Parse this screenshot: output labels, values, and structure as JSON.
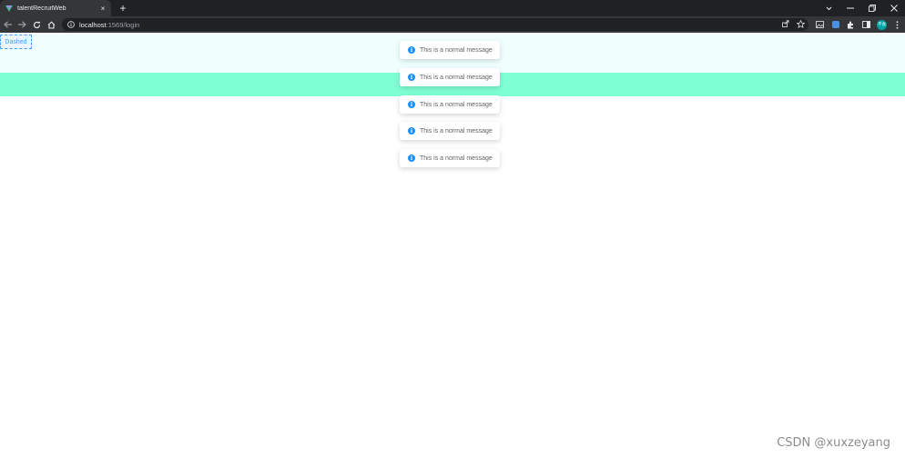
{
  "browser": {
    "tab_title": "talentRecruitWeb",
    "url_host": "localhost",
    "url_path": ":1569/login",
    "avatar_initials": "不会",
    "new_tab_symbol": "+",
    "close_symbol": "×"
  },
  "page": {
    "dashed_button_label": "Dashed",
    "band_light_color": "#effffe",
    "band_green_color": "#7fffd4",
    "messages": [
      {
        "text": "This is a normal message"
      },
      {
        "text": "This is a normal message"
      },
      {
        "text": "This is a normal message"
      },
      {
        "text": "This is a normal message"
      },
      {
        "text": "This is a normal message"
      }
    ],
    "message_icon": "info-icon",
    "message_icon_glyph": "i",
    "watermark": "CSDN @xuxzeyang"
  }
}
